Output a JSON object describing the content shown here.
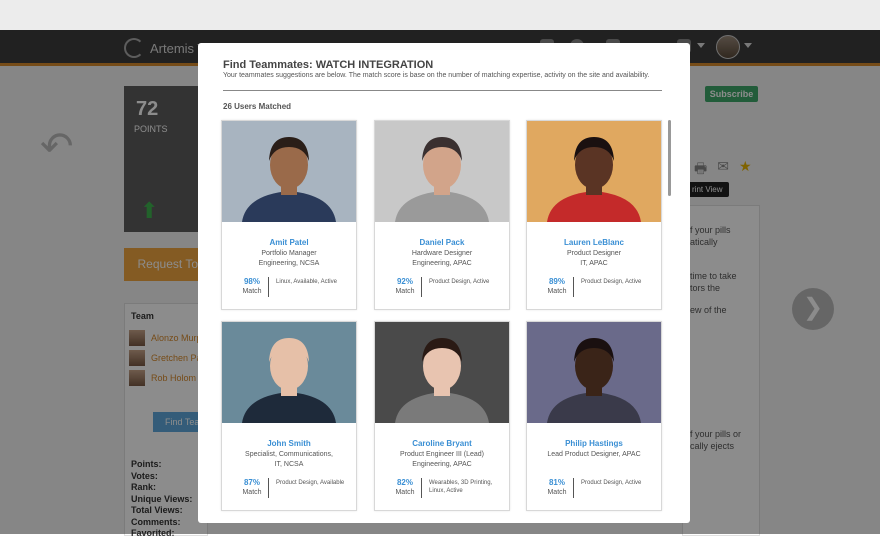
{
  "app": {
    "title": "Artemis Tea"
  },
  "page": {
    "points": {
      "value": "72",
      "label": "POINTS"
    },
    "request_button": "Request To",
    "team": {
      "title": "Team",
      "members": [
        {
          "name": "Alonzo Murp"
        },
        {
          "name": "Gretchen Pa"
        },
        {
          "name": "Rob Holom"
        }
      ]
    },
    "find_button": "Find Tea",
    "stats": [
      "Points:",
      "Votes:",
      "Rank:",
      "Unique Views:",
      "Total Views:",
      "Comments:",
      "Favorited:"
    ],
    "subscribe": "Subscribe",
    "tooltip": "rint View",
    "right_text": [
      "f your pills",
      "atically",
      "time to take",
      "tors the",
      "ew of the",
      "f your pills or",
      "cally ejects"
    ]
  },
  "modal": {
    "title": "Find Teammates: WATCH INTEGRATION",
    "subtitle": "Your teammates suggestions are below. The match score is base on the number of matching expertise, activity on the site and availability.",
    "count": "26 Users Matched",
    "match_label": "Match",
    "cards": [
      {
        "name": "Amit Patel",
        "role": [
          "Portfolio Manager",
          "Engineering, NCSA"
        ],
        "match": "98%",
        "tags": "Linux, Available, Active",
        "skin": "#9a6a4a",
        "hair": "#2a1e18",
        "bg": "#a8b4c0",
        "shirt": "#2a3a5a"
      },
      {
        "name": "Daniel Pack",
        "role": [
          "Hardware Designer",
          "Engineering, APAC"
        ],
        "match": "92%",
        "tags": "Product Design, Active",
        "skin": "#d2a48a",
        "hair": "#3a3030",
        "bg": "#c8c8c8",
        "shirt": "#9a9a9a"
      },
      {
        "name": "Lauren LeBlanc",
        "role": [
          "Product Designer",
          "IT, APAC"
        ],
        "match": "89%",
        "tags": "Product Design, Active",
        "skin": "#5a3424",
        "hair": "#1a1010",
        "bg": "#e0a860",
        "shirt": "#c42a2a"
      },
      {
        "name": "John Smith",
        "role": [
          "Specialist, Communications,",
          "IT, NCSA"
        ],
        "match": "87%",
        "tags": "Product Design, Available",
        "skin": "#e6c0a8",
        "hair": "#e6c0a8",
        "bg": "#6a8a9a",
        "shirt": "#1e2a3a"
      },
      {
        "name": "Caroline Bryant",
        "role": [
          "Product Engineer III (Lead)",
          "Engineering, APAC"
        ],
        "match": "82%",
        "tags": "Wearables, 3D Printing, Linux, Active",
        "skin": "#e8c4b0",
        "hair": "#2a1a14",
        "bg": "#4a4a4a",
        "shirt": "#7a7a7a"
      },
      {
        "name": "Philip Hastings",
        "role": [
          "Lead Product Designer, APAC"
        ],
        "match": "81%",
        "tags": "Product Design, Active",
        "skin": "#3a2418",
        "hair": "#1a1010",
        "bg": "#6a6a8a",
        "shirt": "#3a3a4a"
      }
    ]
  }
}
